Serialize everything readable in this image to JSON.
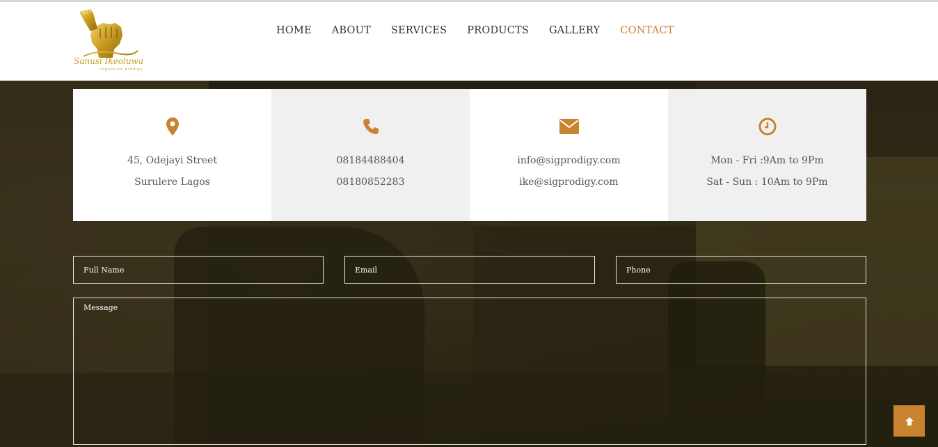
{
  "brand": {
    "logo_text": "Sanusi Ikeoluwa",
    "logo_subtext": "Signature Prodigy"
  },
  "nav": {
    "items": [
      {
        "label": "HOME"
      },
      {
        "label": "ABOUT"
      },
      {
        "label": "SERVICES"
      },
      {
        "label": "PRODUCTS"
      },
      {
        "label": "GALLERY"
      },
      {
        "label": "CONTACT",
        "active": true
      }
    ]
  },
  "info": {
    "address": {
      "icon": "map-marker-icon",
      "line1": "45, Odejayi Street",
      "line2": "Surulere Lagos"
    },
    "phone": {
      "icon": "phone-icon",
      "line1": "08184488404",
      "line2": "08180852283"
    },
    "email": {
      "icon": "envelope-icon",
      "line1": "info@sigprodigy.com",
      "line2": "ike@sigprodigy.com"
    },
    "hours": {
      "icon": "clock-icon",
      "line1": "Mon - Fri :9Am to 9Pm",
      "line2": "Sat - Sun : 10Am to 9Pm"
    }
  },
  "form": {
    "name_placeholder": "Full Name",
    "email_placeholder": "Email",
    "phone_placeholder": "Phone",
    "message_placeholder": "Message"
  },
  "scroll_top": {
    "icon": "arrow-up-icon"
  },
  "colors": {
    "accent": "#c9822f",
    "nav_text": "#333333",
    "info_text": "#555555",
    "box_grey": "#f0f0f0"
  }
}
